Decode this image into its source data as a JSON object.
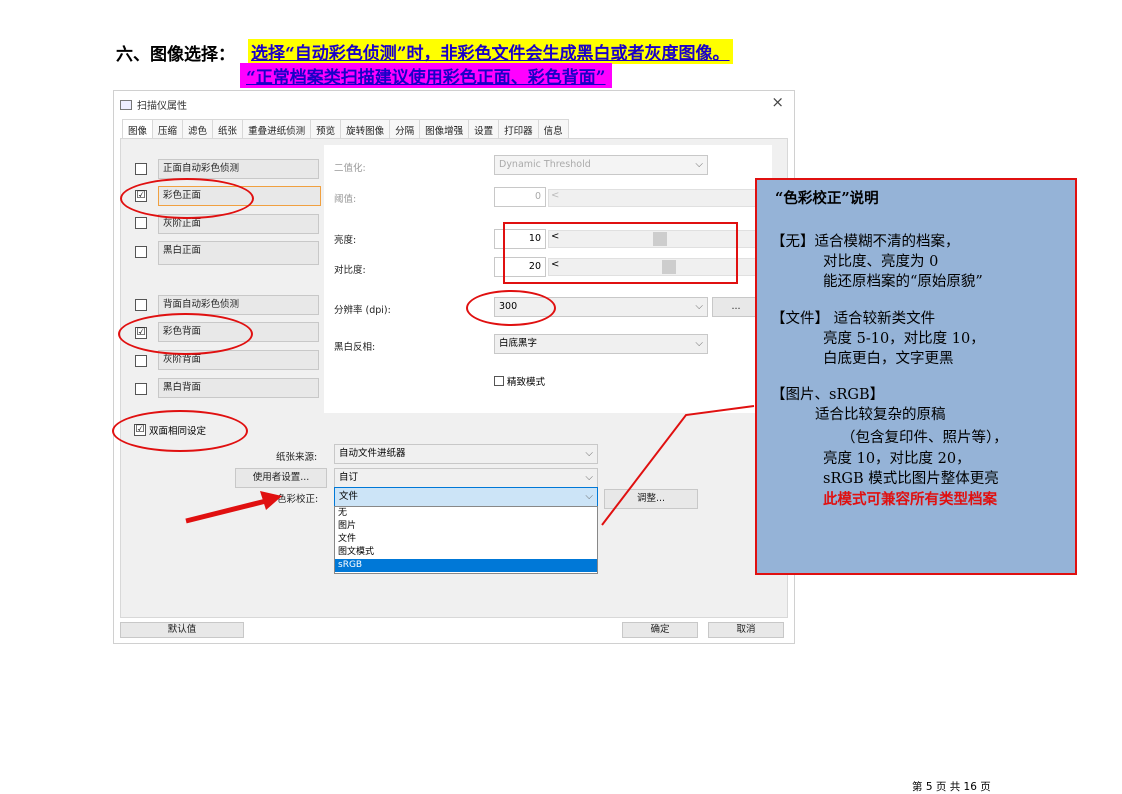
{
  "heading": {
    "label": "六、图像选择：",
    "line1": "选择“自动彩色侦测”时，非彩色文件会生成黑白或者灰度图像。",
    "line2": "“正常档案类扫描建议使用彩色正面、彩色背面”"
  },
  "dialog": {
    "title": "扫描仪属性",
    "close": "×",
    "tabs": [
      "图像",
      "压缩",
      "滤色",
      "纸张",
      "重叠进纸侦测",
      "预览",
      "旋转图像",
      "分隔",
      "图像增强",
      "设置",
      "打印器",
      "信息"
    ],
    "front_options": [
      {
        "label": "正面自动彩色侦测",
        "checked": false
      },
      {
        "label": "彩色正面",
        "checked": true
      },
      {
        "label": "灰阶正面",
        "checked": false
      },
      {
        "label": "黑白正面",
        "checked": false
      }
    ],
    "back_options": [
      {
        "label": "背面自动彩色侦测",
        "checked": false
      },
      {
        "label": "彩色背面",
        "checked": true
      },
      {
        "label": "灰阶背面",
        "checked": false
      },
      {
        "label": "黑白背面",
        "checked": false
      }
    ],
    "checked_mark": "☑",
    "binarize_label": "二值化:",
    "binarize_value": "Dynamic Threshold",
    "threshold_label": "阈值:",
    "threshold_value": "0",
    "brightness_label": "亮度:",
    "brightness_value": "10",
    "contrast_label": "对比度:",
    "contrast_value": "20",
    "resolution_label": "分辨率 (dpi):",
    "resolution_value": "300",
    "resolution_button": "...",
    "invert_label": "黑白反相:",
    "invert_value": "白底黑字",
    "fine_mode_label": "精致模式",
    "duplex_label": "双面相同设定",
    "paper_source_label": "纸张来源:",
    "paper_source_value": "自动文件进纸器",
    "user_settings_button": "使用者设置...",
    "user_settings_value": "自订",
    "color_correction_label": "色彩校正:",
    "color_correction_value": "文件",
    "adjust_button": "调整...",
    "dropdown_options": [
      "无",
      "图片",
      "文件",
      "图文模式",
      "sRGB"
    ],
    "default_button": "默认值",
    "ok_button": "确定",
    "cancel_button": "取消"
  },
  "info_panel": {
    "title": "“色彩校正”说明",
    "none_head": "【无】适合模糊不清的档案，",
    "none_l2": "对比度、亮度为 0",
    "none_l3": "能还原档案的“原始原貌”",
    "doc_head": "【文件】 适合较新类文件",
    "doc_l2": "亮度 5-10，对比度 10，",
    "doc_l3": "白底更白，文字更黑",
    "pic_head": "【图片、sRGB】",
    "pic_l2": "适合比较复杂的原稿",
    "pic_l3": "（包含复印件、照片等），",
    "pic_l4": "亮度 10，对比度 20，",
    "pic_l5": "sRGB 模式比图片整体更亮",
    "pic_l6": "此模式可兼容所有类型档案"
  },
  "footer": "第 5 页 共 16 页",
  "colors": {
    "highlight_yellow": "#ffff00",
    "highlight_magenta": "#ff00ff",
    "annotation_red": "#e01010",
    "panel_blue": "#95b3d7",
    "text_blue": "#1a00c8"
  }
}
